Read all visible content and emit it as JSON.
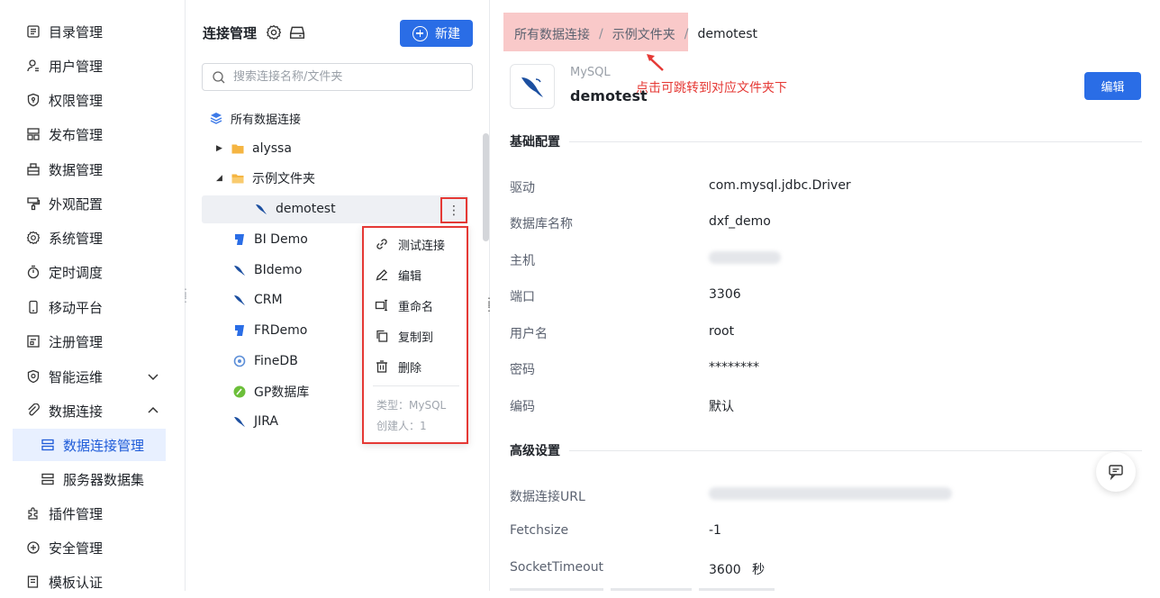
{
  "nav": {
    "items": [
      {
        "label": "目录管理",
        "icon": "catalog-icon"
      },
      {
        "label": "用户管理",
        "icon": "user-icon"
      },
      {
        "label": "权限管理",
        "icon": "shield-icon"
      },
      {
        "label": "发布管理",
        "icon": "publish-icon"
      },
      {
        "label": "数据管理",
        "icon": "data-icon"
      },
      {
        "label": "外观配置",
        "icon": "paint-icon"
      },
      {
        "label": "系统管理",
        "icon": "gear-icon"
      },
      {
        "label": "定时调度",
        "icon": "timer-icon"
      },
      {
        "label": "移动平台",
        "icon": "mobile-icon"
      },
      {
        "label": "注册管理",
        "icon": "register-icon"
      },
      {
        "label": "智能运维",
        "icon": "ops-icon"
      },
      {
        "label": "数据连接",
        "icon": "link-icon"
      },
      {
        "label": "数据连接管理",
        "icon": "connection-manage-icon"
      },
      {
        "label": "服务器数据集",
        "icon": "server-dataset-icon"
      },
      {
        "label": "插件管理",
        "icon": "plugin-icon"
      },
      {
        "label": "安全管理",
        "icon": "security-icon"
      },
      {
        "label": "模板认证",
        "icon": "template-icon"
      }
    ]
  },
  "mid": {
    "title": "连接管理",
    "new_label": "新建",
    "search_placeholder": "搜索连接名称/文件夹",
    "tree": {
      "root": "所有数据连接",
      "folder1": "alyssa",
      "folder2": "示例文件夹",
      "selected": "demotest",
      "items": [
        "BI Demo",
        "BIdemo",
        "CRM",
        "FRDemo",
        "FineDB",
        "GP数据库",
        "JIRA"
      ]
    },
    "context_menu": {
      "items": [
        "测试连接",
        "编辑",
        "重命名",
        "复制到",
        "删除"
      ],
      "type_info": "类型：MySQL",
      "creator_info": "创建人：1"
    }
  },
  "right": {
    "breadcrumb": [
      "所有数据连接",
      "示例文件夹",
      "demotest"
    ],
    "breadcrumb_sep": "/",
    "annotation": "点击可跳转到对应文件夹下",
    "db_type": "MySQL",
    "db_name": "demotest",
    "edit_label": "编辑",
    "basic_section": "基础配置",
    "advanced_section": "高级设置",
    "basic": [
      {
        "label": "驱动",
        "value": "com.mysql.jdbc.Driver"
      },
      {
        "label": "数据库名称",
        "value": "dxf_demo"
      },
      {
        "label": "主机",
        "value": ""
      },
      {
        "label": "端口",
        "value": "3306"
      },
      {
        "label": "用户名",
        "value": "root"
      },
      {
        "label": "密码",
        "value": "********"
      },
      {
        "label": "编码",
        "value": "默认"
      }
    ],
    "advanced": [
      {
        "label": "数据连接URL",
        "value": ""
      },
      {
        "label": "Fetchsize",
        "value": "-1"
      },
      {
        "label": "SocketTimeout",
        "value": "3600",
        "unit": "秒"
      }
    ]
  },
  "colors": {
    "primary": "#2a6de6",
    "annotation": "#e53935",
    "highlight": "#f9c9c9"
  }
}
